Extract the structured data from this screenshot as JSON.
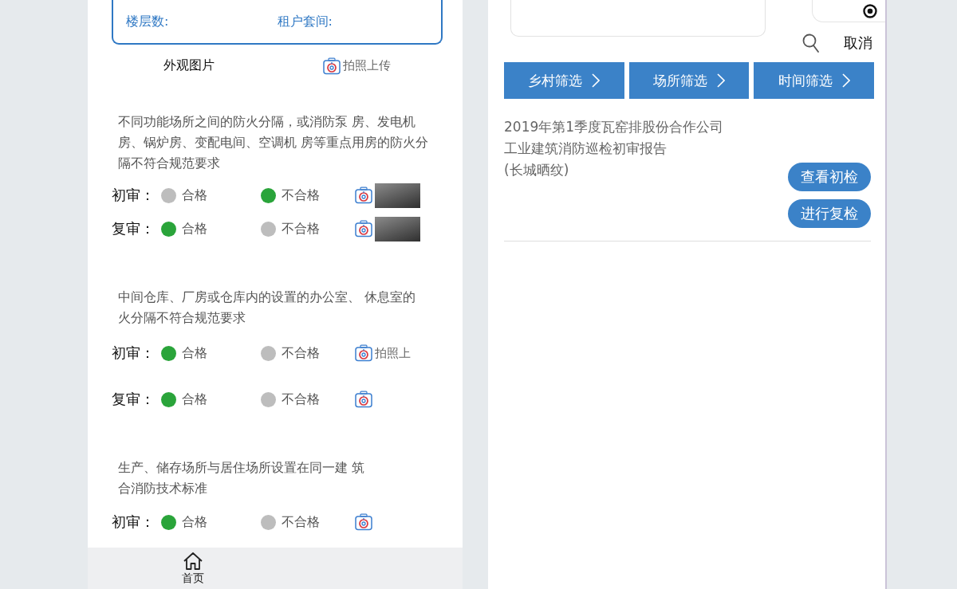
{
  "inspection_phone": {
    "info_card": {
      "fields": [
        "楼层数:",
        "租户套间:"
      ]
    },
    "photo_section": {
      "label": "外观图片",
      "upload_label": "拍照上传"
    },
    "items": [
      {
        "lines": [
          "不同功能场所之间的防火分隔，或消防泵 房、发电机",
          "房、锅炉房、变配电间、空调机 房等重点用房的防火分",
          "隔不符合规范要求"
        ],
        "reviews": [
          {
            "label": "初审：",
            "options": [
              {
                "label": "合格",
                "selected": false
              },
              {
                "label": "不合格",
                "selected": true
              }
            ],
            "photo": true
          },
          {
            "label": "复审：",
            "options": [
              {
                "label": "合格",
                "selected": true
              },
              {
                "label": "不合格",
                "selected": false
              }
            ],
            "photo": true
          }
        ]
      },
      {
        "lines": [
          "中间仓库、厂房或仓库内的设置的办公室、 休息室的",
          "火分隔不符合规范要求"
        ],
        "reviews": [
          {
            "label": "初审：",
            "options": [
              {
                "label": "合格",
                "selected": true
              },
              {
                "label": "不合格",
                "selected": false
              }
            ],
            "photo": false,
            "upload_label": "拍照上"
          },
          {
            "label": "复审：",
            "options": [
              {
                "label": "合格",
                "selected": true
              },
              {
                "label": "不合格",
                "selected": false
              }
            ],
            "photo": false
          }
        ]
      },
      {
        "lines": [
          "生产、储存场所与居住场所设置在同一建 筑",
          "合消防技术标准"
        ],
        "reviews": [
          {
            "label": "初审：",
            "options": [
              {
                "label": "合格",
                "selected": true
              },
              {
                "label": "不合格",
                "selected": false
              }
            ],
            "photo": false
          }
        ]
      }
    ],
    "tab_bar": [
      {
        "label": "首页"
      }
    ]
  },
  "report_phone": {
    "cancel_label": "取消",
    "filters": [
      "乡村筛选",
      "场所筛选",
      "时间筛选"
    ],
    "reports": [
      {
        "title_lines": [
          "2019年第1季度瓦窑排股份合作公司",
          "工业建筑消防巡检初审报告",
          "(长城晒纹)"
        ],
        "actions": [
          "查看初检",
          "进行复检"
        ]
      }
    ]
  }
}
